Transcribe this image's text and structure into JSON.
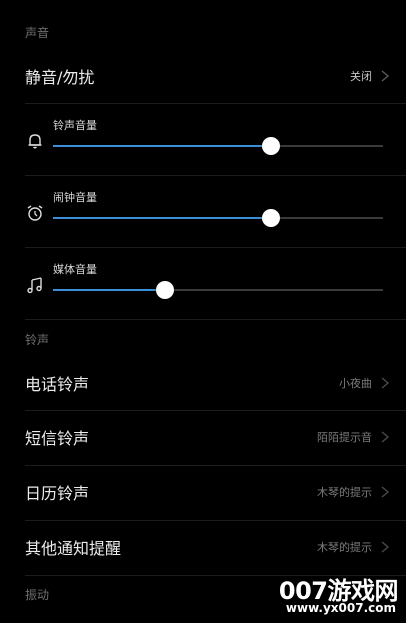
{
  "sound": {
    "header": "声音",
    "mute": {
      "label": "静音/勿扰",
      "value": "关闭"
    },
    "volumes": [
      {
        "icon": "bell-icon",
        "label": "铃声音量",
        "level": 0.66
      },
      {
        "icon": "alarm-clock-icon",
        "label": "闹钟音量",
        "level": 0.66
      },
      {
        "icon": "music-note-icon",
        "label": "媒体音量",
        "level": 0.34
      }
    ]
  },
  "ringtones": {
    "header": "铃声",
    "items": [
      {
        "label": "电话铃声",
        "value": "小夜曲"
      },
      {
        "label": "短信铃声",
        "value": "陌陌提示音"
      },
      {
        "label": "日历铃声",
        "value": "木琴的提示"
      },
      {
        "label": "其他通知提醒",
        "value": "木琴的提示"
      }
    ]
  },
  "vibration": {
    "header": "振动"
  },
  "watermark": {
    "main": "007游戏网",
    "url": "www.yx007.com"
  },
  "colors": {
    "background": "#000000",
    "accent": "#3a8fd6",
    "thumb": "#ffffff",
    "track": "#3a3a3a"
  }
}
